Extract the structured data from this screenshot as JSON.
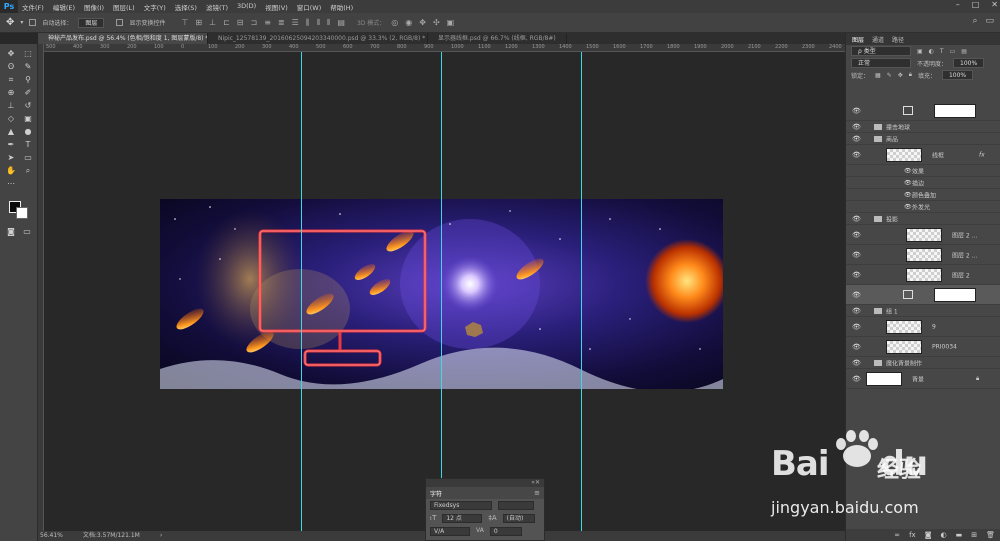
{
  "app": {
    "logo": "Ps"
  },
  "menubar": {
    "items": [
      "文件(F)",
      "编辑(E)",
      "图像(I)",
      "图层(L)",
      "文字(Y)",
      "选择(S)",
      "滤镜(T)",
      "3D(D)",
      "视图(V)",
      "窗口(W)",
      "帮助(H)"
    ]
  },
  "options": {
    "auto_select_label": "自动选择：",
    "auto_select_value": "图层",
    "show_transform": "显示变换控件",
    "mode_3d": "3D 模式："
  },
  "tabs": [
    {
      "label": "神秘产品发布.psd @ 56.4% (色相/饱和度 1, 图层蒙版/8) *",
      "active": true
    },
    {
      "label": "Nipic_12578139_20160625094203340000.psd @ 33.3% (2, RGB/8) *",
      "active": false
    },
    {
      "label": "显示器线框.psd @ 66.7% (线框, RGB/8#)",
      "active": false
    }
  ],
  "ruler": {
    "ticks": [
      "500",
      "400",
      "300",
      "200",
      "100",
      "0",
      "100",
      "200",
      "300",
      "400",
      "500",
      "600",
      "700",
      "800",
      "900",
      "1000",
      "1100",
      "1200",
      "1300",
      "1400",
      "1500",
      "1600",
      "1700",
      "1800",
      "1900",
      "2000",
      "2100",
      "2200",
      "2300",
      "2400"
    ]
  },
  "status": {
    "zoom": "56.41%",
    "doc": "文档:3.57M/121.1M"
  },
  "char_panel": {
    "title": "字符",
    "font": "Fixedsys",
    "size": "12 点",
    "leading": "(自动)",
    "kerning": "V/A",
    "tracking": "0"
  },
  "right_panel": {
    "tabs": [
      "图层",
      "通道",
      "路径"
    ],
    "filter": "ρ 类型",
    "blend": "正常",
    "opacity_label": "不透明度：",
    "opacity": "100%",
    "lock_label": "锁定：",
    "fill_label": "填充：",
    "fill": "100%",
    "layers": [
      {
        "name": "",
        "kind": "adjust"
      },
      {
        "name": "撞击地球",
        "kind": "group"
      },
      {
        "name": "商品",
        "kind": "group"
      },
      {
        "name": "线框",
        "kind": "layer",
        "fx": "fx"
      },
      {
        "name": "效果",
        "kind": "effect"
      },
      {
        "name": "描边",
        "kind": "effect"
      },
      {
        "name": "颜色叠加",
        "kind": "effect"
      },
      {
        "name": "外发光",
        "kind": "effect"
      },
      {
        "name": "投影",
        "kind": "group"
      },
      {
        "name": "图层 2 ...",
        "kind": "layer"
      },
      {
        "name": "图层 2 ...",
        "kind": "layer"
      },
      {
        "name": "图层 2",
        "kind": "layer"
      },
      {
        "name": "",
        "kind": "adjust-selected"
      },
      {
        "name": "组 1",
        "kind": "group"
      },
      {
        "name": "9",
        "kind": "layer"
      },
      {
        "name": "PRI0034",
        "kind": "layer"
      },
      {
        "name": "魔化背景制作",
        "kind": "group"
      },
      {
        "name": "背景",
        "kind": "bg"
      }
    ]
  },
  "watermark": {
    "brand": "Bai",
    "brand2": "du",
    "cn": "经验",
    "url": "jingyan.baidu.com"
  }
}
